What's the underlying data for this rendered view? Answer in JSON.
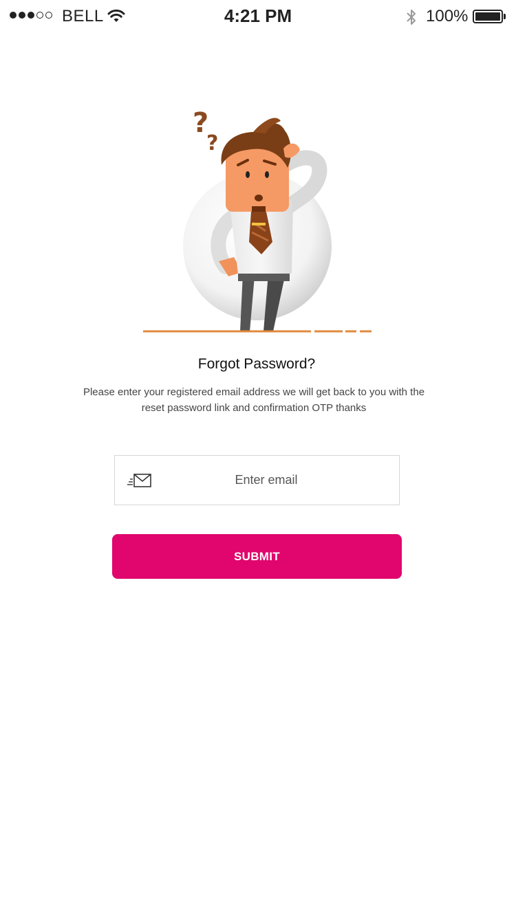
{
  "status_bar": {
    "carrier": "BELL",
    "time": "4:21 PM",
    "battery_percent": "100%",
    "signal_strength": 3,
    "signal_total": 5,
    "battery_level": 1.0
  },
  "illustration": {
    "description_icon": "confused-man-icon",
    "accent_color": "#e08a3c"
  },
  "forgot_password": {
    "title": "Forgot Password?",
    "description": "Please enter your registered email address we will get back to you with the reset password link and confirmation OTP thanks"
  },
  "email_field": {
    "icon": "mail-icon",
    "placeholder": "Enter email",
    "value": ""
  },
  "submit_button": {
    "label": "SUBMIT",
    "color": "#e0066d"
  }
}
